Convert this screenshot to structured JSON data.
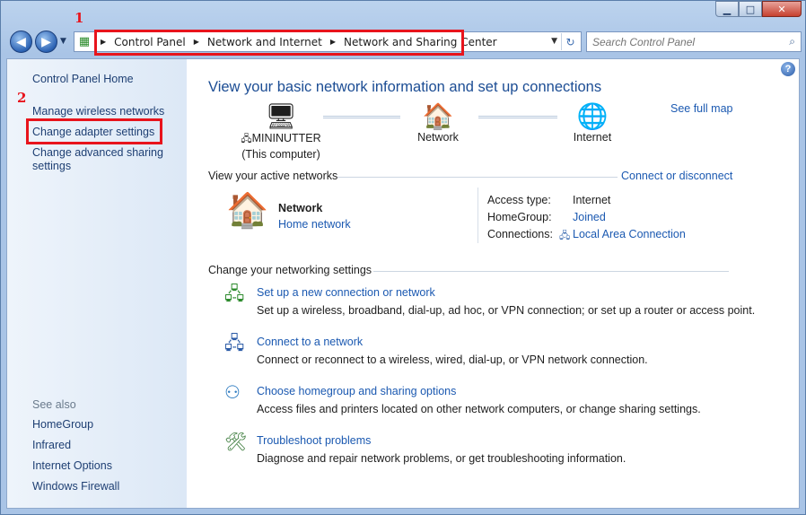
{
  "window": {
    "minimize_glyph": "▁",
    "maximize_glyph": "□",
    "close_glyph": "✕"
  },
  "nav": {
    "back_glyph": "◀",
    "forward_glyph": "▶",
    "recent_glyph": "▼",
    "breadcrumbs": [
      "Control Panel",
      "Network and Internet",
      "Network and Sharing Center"
    ],
    "crumb_sep": "▶",
    "dropdown_glyph": "▼",
    "refresh_glyph": "↻",
    "search_placeholder": "Search Control Panel",
    "search_glyph": "⌕"
  },
  "annotations": {
    "num1": "1",
    "num2": "2"
  },
  "sidebar": {
    "home": "Control Panel Home",
    "tasks": [
      "Manage wireless networks",
      "Change adapter settings",
      "Change advanced sharing settings"
    ],
    "see_also_label": "See also",
    "see_also": [
      "HomeGroup",
      "Infrared",
      "Internet Options",
      "Windows Firewall"
    ]
  },
  "main": {
    "help_glyph": "?",
    "title": "View your basic network information and set up connections",
    "see_full_map": "See full map",
    "nodes": [
      {
        "label": "MININUTTER",
        "sublabel": "(This computer)",
        "icon": "computer-icon",
        "glyph": "🖥"
      },
      {
        "label": "Network",
        "icon": "network-house-icon",
        "glyph": "🏠"
      },
      {
        "label": "Internet",
        "icon": "globe-icon",
        "glyph": "🌐"
      }
    ],
    "active_networks_heading": "View your active networks",
    "connect_or_disconnect": "Connect or disconnect",
    "active_network": {
      "icon_glyph": "🏠",
      "name": "Network",
      "type": "Home network",
      "properties": [
        {
          "label": "Access type:",
          "value": "Internet",
          "is_link": false
        },
        {
          "label": "HomeGroup:",
          "value": "Joined",
          "is_link": true
        },
        {
          "label": "Connections:",
          "value": "Local Area Connection",
          "is_link": true,
          "icon_glyph": "🖧"
        }
      ]
    },
    "change_settings_heading": "Change your networking settings",
    "tasks": [
      {
        "title": "Set up a new connection or network",
        "desc": "Set up a wireless, broadband, dial-up, ad hoc, or VPN connection; or set up a router or access point.",
        "icon": "new-connection-icon",
        "glyph": "🖧"
      },
      {
        "title": "Connect to a network",
        "desc": "Connect or reconnect to a wireless, wired, dial-up, or VPN network connection.",
        "icon": "connect-network-icon",
        "glyph": "🖧"
      },
      {
        "title": "Choose homegroup and sharing options",
        "desc": "Access files and printers located on other network computers, or change sharing settings.",
        "icon": "homegroup-icon",
        "glyph": "⚇"
      },
      {
        "title": "Troubleshoot problems",
        "desc": "Diagnose and repair network problems, or get troubleshooting information.",
        "icon": "troubleshoot-icon",
        "glyph": "🛠"
      }
    ]
  }
}
